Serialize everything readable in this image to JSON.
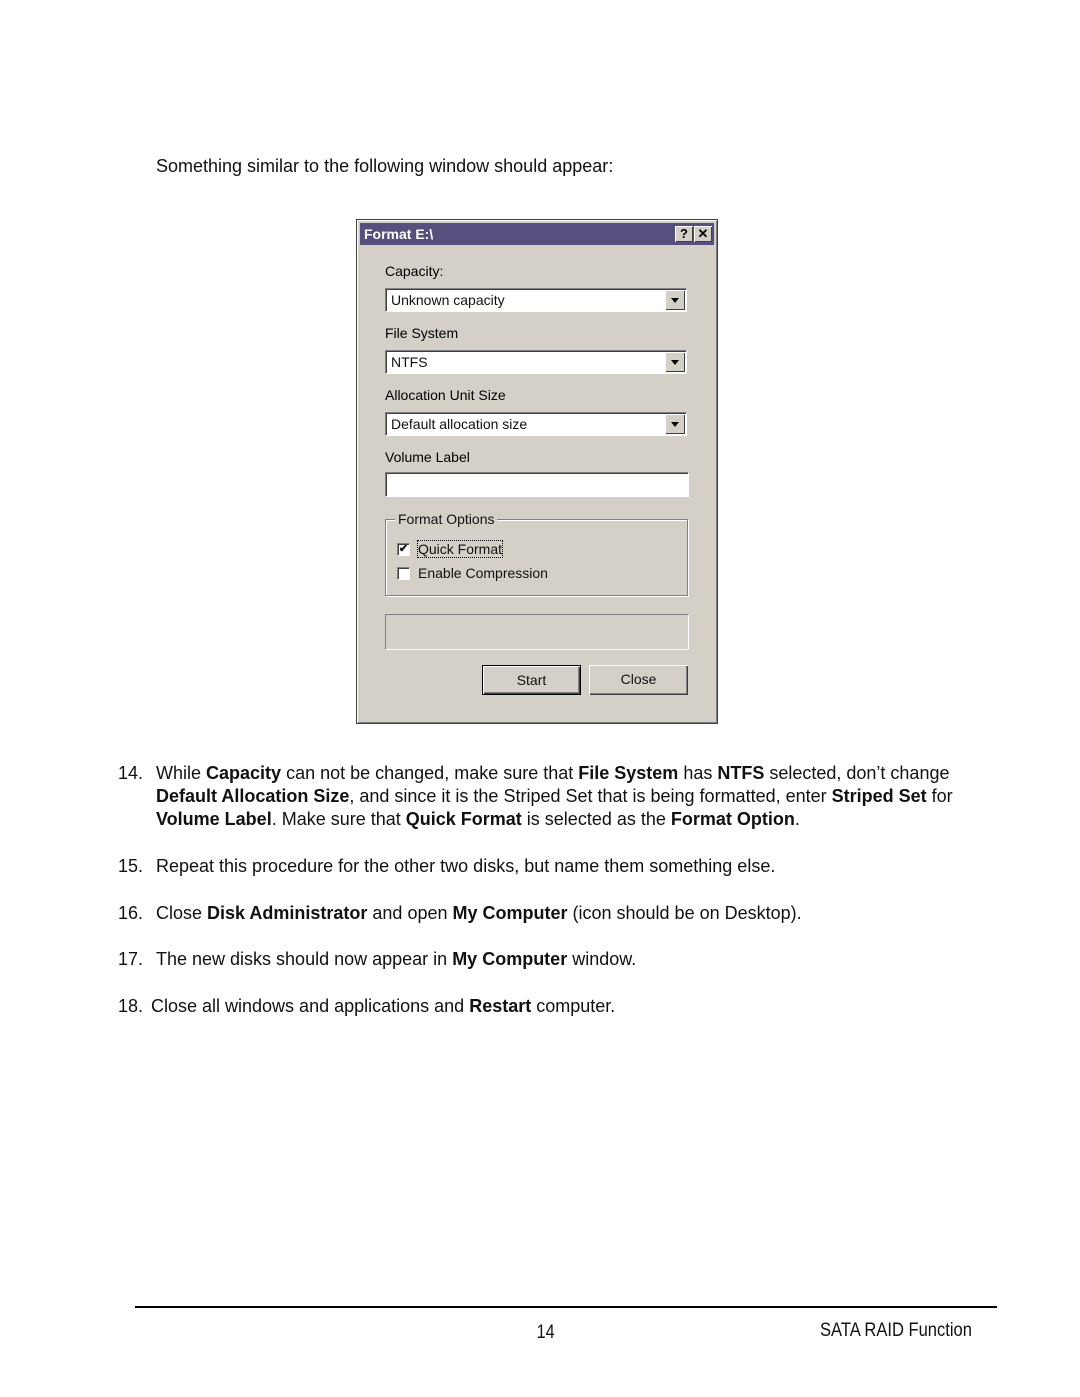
{
  "intro": "Something similar to the following window should appear:",
  "dialog": {
    "title": "Format E:\\",
    "help_button": "?",
    "close_button": "✕",
    "capacity_label": "Capacity:",
    "capacity_value": "Unknown capacity",
    "filesystem_label": "File System",
    "filesystem_value": "NTFS",
    "allocation_label": "Allocation Unit Size",
    "allocation_value": "Default allocation size",
    "volume_label": "Volume Label",
    "volume_value": "",
    "format_options_label": "Format Options",
    "quick_format_label": "Quick Format",
    "quick_format_checked": true,
    "compression_label": "Enable Compression",
    "compression_checked": false,
    "start_button": "Start",
    "close_button_label": "Close"
  },
  "steps": [
    {
      "num": "14.",
      "parts": [
        [
          "While ",
          false
        ],
        [
          "Capacity",
          true
        ],
        [
          " can not be changed, make sure that ",
          false
        ],
        [
          "File System",
          true
        ],
        [
          " has ",
          false
        ],
        [
          "NTFS",
          true
        ],
        [
          " selected, don’t change ",
          false
        ],
        [
          "Default Allocation Size",
          true
        ],
        [
          ", and since it is the Striped Set that is being formatted, enter ",
          false
        ],
        [
          "Striped Set",
          true
        ],
        [
          " for ",
          false
        ],
        [
          "Volume Label",
          true
        ],
        [
          ". Make sure that ",
          false
        ],
        [
          "Quick Format",
          true
        ],
        [
          " is selected as the ",
          false
        ],
        [
          "Format Option",
          true
        ],
        [
          ".",
          false
        ]
      ]
    },
    {
      "num": "15.",
      "parts": [
        [
          "Repeat this procedure for the other two disks, but name them something else.",
          false
        ]
      ]
    },
    {
      "num": "16.",
      "parts": [
        [
          "Close ",
          false
        ],
        [
          "Disk Administrator",
          true
        ],
        [
          " and open ",
          false
        ],
        [
          "My Computer",
          true
        ],
        [
          " (icon should be on Desktop).",
          false
        ]
      ]
    },
    {
      "num": "17.",
      "parts": [
        [
          "The new disks should now appear in ",
          false
        ],
        [
          "My Computer",
          true
        ],
        [
          " window.",
          false
        ]
      ]
    },
    {
      "num": "18.",
      "parts": [
        [
          "Close all windows and applications and ",
          false
        ],
        [
          "Restart",
          true
        ],
        [
          " computer.",
          false
        ]
      ]
    }
  ],
  "footer": {
    "page_number": "14",
    "section": "SATA RAID Function"
  }
}
